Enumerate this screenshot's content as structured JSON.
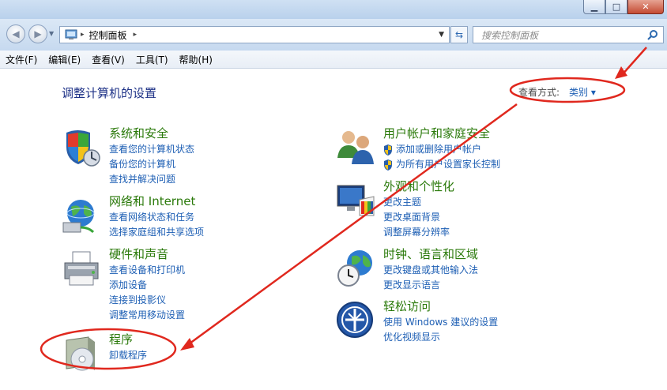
{
  "window": {
    "min": "▁",
    "max": "□",
    "close": "✕"
  },
  "address": {
    "breadcrumb": "控制面板",
    "sep": "▸"
  },
  "search": {
    "placeholder": "搜索控制面板"
  },
  "menu": [
    "文件(F)",
    "编辑(E)",
    "查看(V)",
    "工具(T)",
    "帮助(H)"
  ],
  "header": {
    "title": "调整计算机的设置",
    "view_label": "查看方式:",
    "view_value": "类别 ▾"
  },
  "categories": [
    {
      "title": "系统和安全",
      "icon": "shield-icon",
      "links": [
        "查看您的计算机状态",
        "备份您的计算机",
        "查找并解决问题"
      ]
    },
    {
      "title": "网络和 Internet",
      "icon": "globe-network-icon",
      "links": [
        "查看网络状态和任务",
        "选择家庭组和共享选项"
      ]
    },
    {
      "title": "硬件和声音",
      "icon": "printer-icon",
      "links": [
        "查看设备和打印机",
        "添加设备",
        "连接到投影仪",
        "调整常用移动设置"
      ]
    },
    {
      "title": "程序",
      "icon": "programs-disc-icon",
      "links": [
        "卸载程序"
      ]
    },
    {
      "title": "用户帐户和家庭安全",
      "icon": "users-icon",
      "links": [
        "添加或删除用户帐户",
        "为所有用户设置家长控制"
      ]
    },
    {
      "title": "外观和个性化",
      "icon": "monitor-palette-icon",
      "links": [
        "更改主题",
        "更改桌面背景",
        "调整屏幕分辨率"
      ]
    },
    {
      "title": "时钟、语言和区域",
      "icon": "clock-globe-icon",
      "links": [
        "更改键盘或其他输入法",
        "更改显示语言"
      ]
    },
    {
      "title": "轻松访问",
      "icon": "ease-of-access-icon",
      "links": [
        "使用 Windows 建议的设置",
        "优化视频显示"
      ]
    }
  ],
  "colors": {
    "annotation": "#e0281e",
    "link": "#1e5fb4",
    "category_title": "#2b7a0b",
    "heading": "#1e3287"
  }
}
